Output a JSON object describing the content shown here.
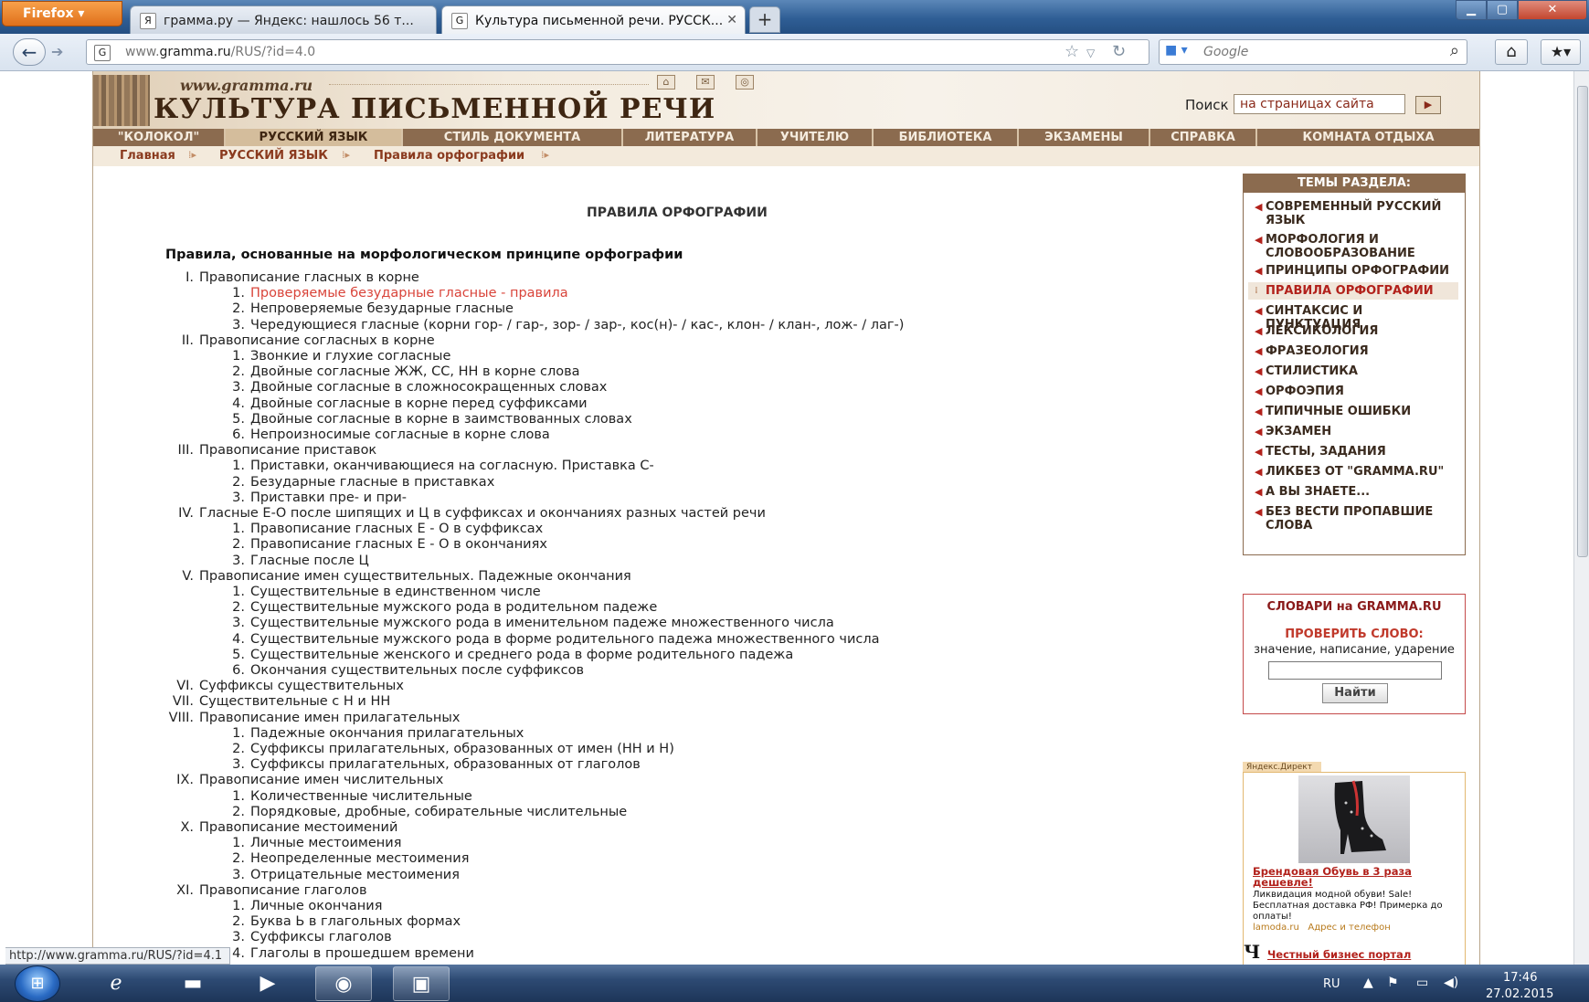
{
  "browser": {
    "menu_button": "Firefox",
    "tabs": [
      {
        "title": "грамма.ру — Яндекс: нашлось 56 т...",
        "favicon": "Я"
      },
      {
        "title": "Культура письменной речи. РУССК...",
        "favicon": "G"
      }
    ],
    "url": {
      "prefix": "www.",
      "host": "gramma.ru",
      "path": "/RUS/?id=4.0"
    },
    "search_placeholder": "Google",
    "status_url": "http://www.gramma.ru/RUS/?id=4.1"
  },
  "site": {
    "url": "www.gramma.ru",
    "name": "КУЛЬТУРА ПИСЬМЕННОЙ РЕЧИ",
    "search_label": "Поиск",
    "search_value": "на страницах сайта",
    "nav": [
      "\"КОЛОКОЛ\"",
      "РУССКИЙ ЯЗЫК",
      "СТИЛЬ ДОКУМЕНТА",
      "ЛИТЕРАТУРА",
      "УЧИТЕЛЮ",
      "БИБЛИОТЕКА",
      "ЭКЗАМЕНЫ",
      "СПРАВКА",
      "КОМНАТА ОТДЫХА"
    ],
    "breadcrumbs": [
      "Главная",
      "РУССКИЙ ЯЗЫК",
      "Правила орфографии"
    ]
  },
  "main": {
    "title": "ПРАВИЛА ОРФОГРАФИИ",
    "heading": "Правила, основанные на морфологическом принципе орфографии",
    "items": [
      {
        "num": "I.",
        "text": "Правописание гласных в корне"
      },
      {
        "num": "1.",
        "text": "Проверяемые безударные гласные - правила"
      },
      {
        "num": "2.",
        "text": "Непроверяемые безударные гласные"
      },
      {
        "num": "3.",
        "text": "Чередующиеся гласные (корни гор- / гар-, зор- / зар-, кос(н)- / кас-, клон- / клан-, лож- / лаг-)"
      },
      {
        "num": "II.",
        "text": "Правописание согласных в корне"
      },
      {
        "num": "1.",
        "text": "Звонкие и глухие согласные"
      },
      {
        "num": "2.",
        "text": "Двойные согласные ЖЖ, СС, НН в корне слова"
      },
      {
        "num": "3.",
        "text": "Двойные согласные в сложносокращенных словах"
      },
      {
        "num": "4.",
        "text": "Двойные согласные в корне перед суффиксами"
      },
      {
        "num": "5.",
        "text": "Двойные согласные в корне в заимствованных словах"
      },
      {
        "num": "6.",
        "text": "Непроизносимые согласные в корне слова"
      },
      {
        "num": "III.",
        "text": "Правописание приставок"
      },
      {
        "num": "1.",
        "text": "Приставки, оканчивающиеся на согласную. Приставка С-"
      },
      {
        "num": "2.",
        "text": "Безударные гласные в приставках"
      },
      {
        "num": "3.",
        "text": "Приставки пре- и при-"
      },
      {
        "num": "IV.",
        "text": "Гласные Е-О после шипящих и Ц в суффиксах и окончаниях разных частей речи"
      },
      {
        "num": "1.",
        "text": "Правописание гласных Е - О в суффиксах"
      },
      {
        "num": "2.",
        "text": "Правописание гласных Е - О в окончаниях"
      },
      {
        "num": "3.",
        "text": "Гласные после Ц"
      },
      {
        "num": "V.",
        "text": "Правописание имен существительных. Падежные окончания"
      },
      {
        "num": "1.",
        "text": "Существительные в единственном числе"
      },
      {
        "num": "2.",
        "text": "Существительные мужского рода в родительном падеже"
      },
      {
        "num": "3.",
        "text": "Существительные мужского рода в именительном падеже множественного числа"
      },
      {
        "num": "4.",
        "text": "Существительные мужского рода в форме родительного падежа множественного числа"
      },
      {
        "num": "5.",
        "text": "Существительные женского и среднего рода в форме родительного падежа"
      },
      {
        "num": "6.",
        "text": "Окончания существительных после суффиксов"
      },
      {
        "num": "VI.",
        "text": "Суффиксы существительных"
      },
      {
        "num": "VII.",
        "text": "Существительные с Н и НН"
      },
      {
        "num": "VIII.",
        "text": "Правописание имен прилагательных"
      },
      {
        "num": "1.",
        "text": "Падежные окончания прилагательных"
      },
      {
        "num": "2.",
        "text": "Суффиксы прилагательных, образованных от имен (НН и Н)"
      },
      {
        "num": "3.",
        "text": "Суффиксы прилагательных, образованных от глаголов"
      },
      {
        "num": "IX.",
        "text": "Правописание имен числительных"
      },
      {
        "num": "1.",
        "text": "Количественные числительные"
      },
      {
        "num": "2.",
        "text": "Порядковые, дробные, собирательные числительные"
      },
      {
        "num": "X.",
        "text": "Правописание местоимений"
      },
      {
        "num": "1.",
        "text": "Личные местоимения"
      },
      {
        "num": "2.",
        "text": "Неопределенные местоимения"
      },
      {
        "num": "3.",
        "text": "Отрицательные местоимения"
      },
      {
        "num": "XI.",
        "text": "Правописание глаголов"
      },
      {
        "num": "1.",
        "text": "Личные окончания"
      },
      {
        "num": "2.",
        "text": "Буква Ь в глагольных формах"
      },
      {
        "num": "3.",
        "text": "Суффиксы глаголов"
      },
      {
        "num": "4.",
        "text": "Глаголы в прошедшем времени"
      }
    ]
  },
  "sidebar": {
    "themes_title": "ТЕМЫ РАЗДЕЛА:",
    "themes": [
      "СОВРЕМЕННЫЙ РУССКИЙ ЯЗЫК",
      "МОРФОЛОГИЯ И СЛОВООБРАЗОВАНИЕ",
      "ПРИНЦИПЫ ОРФОГРАФИИ",
      "ПРАВИЛА ОРФОГРАФИИ",
      "СИНТАКСИС И ПУНКТУАЦИЯ",
      "ЛЕКСИКОЛОГИЯ",
      "ФРАЗЕОЛОГИЯ",
      "СТИЛИСТИКА",
      "ОРФОЭПИЯ",
      "ТИПИЧНЫЕ ОШИБКИ",
      "ЭКЗАМЕН",
      "ТЕСТЫ, ЗАДАНИЯ",
      "ЛИКБЕЗ ОТ \"GRAMMA.RU\"",
      "А ВЫ ЗНАЕТЕ...",
      "БЕЗ ВЕСТИ ПРОПАВШИЕ СЛОВА"
    ],
    "active_theme": "ПРАВИЛА ОРФОГРАФИИ",
    "dict": {
      "title": "СЛОВАРИ на GRAMMA.RU",
      "check": "ПРОВЕРИТЬ СЛОВО:",
      "hint": "значение, написание, ударение",
      "button": "Найти"
    },
    "ad": {
      "label": "Яндекс.Директ",
      "title": "Брендовая Обувь в 3 раза дешевле!",
      "text": "Ликвидация модной обуви! Sale! Бесплатная доставка РФ! Примерка до оплаты!",
      "domain": "lamoda.ru",
      "contacts": "Адрес и телефон",
      "next_letter": "Ч",
      "next_title": "Честный бизнес портал"
    }
  },
  "taskbar": {
    "lang": "RU",
    "time": "17:46",
    "date": "27.02.2015"
  }
}
